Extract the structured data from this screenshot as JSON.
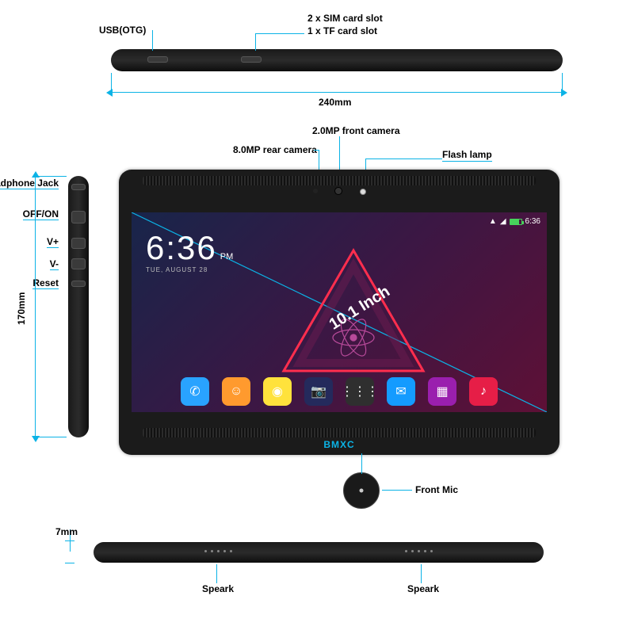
{
  "labels": {
    "usb": "USB(OTG)",
    "sim": "2 x SIM card slot",
    "tf": "1  x TF card slot",
    "width": "240mm",
    "front_cam": "2.0MP front camera",
    "rear_cam": "8.0MP rear camera",
    "flash": "Flash lamp",
    "headphone": "Headphone Jack",
    "off_on": "OFF/ON",
    "vplus": "V+",
    "vminus": "V-",
    "reset": "Reset",
    "height": "170mm",
    "screen_size": "10.1 Inch",
    "front_mic": "Front Mic",
    "thickness": "7mm",
    "speark_l": "Speark",
    "speark_r": "Speark"
  },
  "screen": {
    "time": "6:36",
    "suffix": "PM",
    "date": "TUE, AUGUST 28",
    "brand": "BMXC",
    "status_time": "6:36"
  },
  "apps": [
    {
      "name": "phone",
      "bg": "#29a3ff",
      "glyph": "✆"
    },
    {
      "name": "contacts",
      "bg": "#ff9a2e",
      "glyph": "☺"
    },
    {
      "name": "browser",
      "bg": "#ffe23c",
      "glyph": "◉"
    },
    {
      "name": "camera",
      "bg": "#242a5c",
      "glyph": "📷"
    },
    {
      "name": "apps",
      "bg": "#2f2f2f",
      "glyph": "⋮⋮⋮"
    },
    {
      "name": "sms",
      "bg": "#149bff",
      "glyph": "✉"
    },
    {
      "name": "gallery",
      "bg": "#9a1fae",
      "glyph": "▦"
    },
    {
      "name": "music",
      "bg": "#e61e47",
      "glyph": "♪"
    }
  ]
}
